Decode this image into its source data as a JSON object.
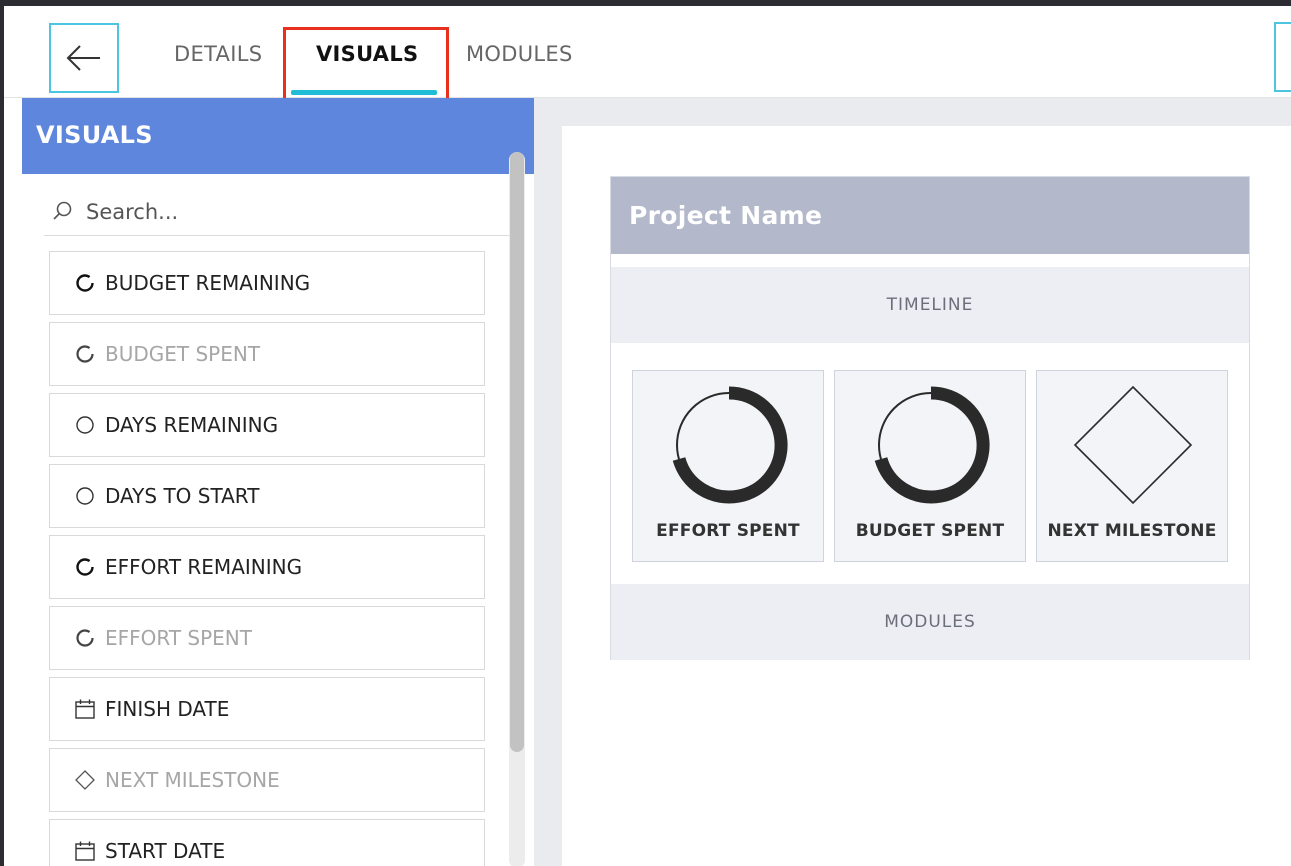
{
  "nav": {
    "back_icon": "arrow-left-icon",
    "tabs": [
      {
        "label": "DETAILS",
        "active": false
      },
      {
        "label": "VISUALS",
        "active": true
      },
      {
        "label": "MODULES",
        "active": false
      }
    ],
    "accent_color": "#21bcd6",
    "highlight_color": "#e8301f"
  },
  "sidebar": {
    "title": "VISUALS",
    "header_color": "#5e86dc",
    "search": {
      "placeholder": "Search...",
      "value": ""
    },
    "items": [
      {
        "label": "BUDGET REMAINING",
        "icon": "ring-icon",
        "disabled": false
      },
      {
        "label": "BUDGET SPENT",
        "icon": "ring-icon",
        "disabled": true
      },
      {
        "label": "DAYS REMAINING",
        "icon": "circle-icon",
        "disabled": false
      },
      {
        "label": "DAYS TO START",
        "icon": "circle-icon",
        "disabled": false
      },
      {
        "label": "EFFORT REMAINING",
        "icon": "ring-icon",
        "disabled": false
      },
      {
        "label": "EFFORT SPENT",
        "icon": "ring-icon",
        "disabled": true
      },
      {
        "label": "FINISH DATE",
        "icon": "calendar-icon",
        "disabled": false
      },
      {
        "label": "NEXT MILESTONE",
        "icon": "diamond-icon",
        "disabled": true
      },
      {
        "label": "START DATE",
        "icon": "calendar-icon",
        "disabled": false
      }
    ]
  },
  "canvas": {
    "project_name": "Project Name",
    "header_color": "#b3b9cb",
    "sections": {
      "timeline": "TIMELINE",
      "modules": "MODULES"
    },
    "widgets": [
      {
        "label": "EFFORT SPENT",
        "icon": "progress-ring-icon"
      },
      {
        "label": "BUDGET SPENT",
        "icon": "progress-ring-icon"
      },
      {
        "label": "NEXT MILESTONE",
        "icon": "diamond-icon"
      }
    ]
  }
}
